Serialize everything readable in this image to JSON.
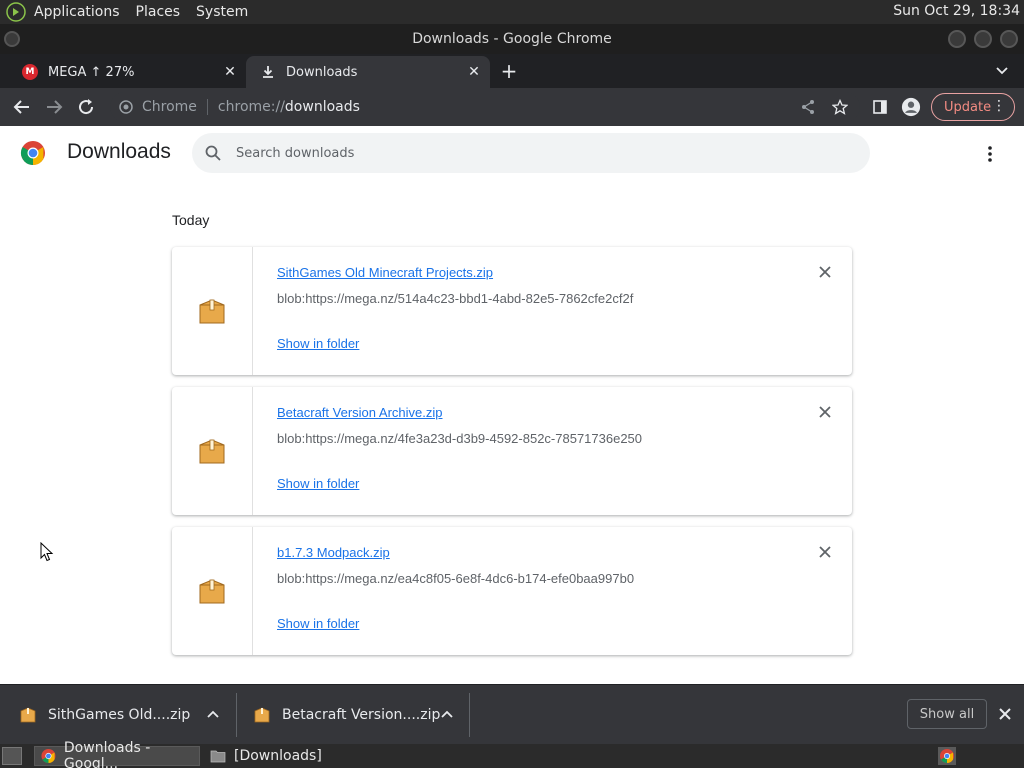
{
  "panel": {
    "menus": [
      "Applications",
      "Places",
      "System"
    ],
    "clock": "Sun Oct 29, 18:34"
  },
  "window": {
    "title": "Downloads - Google Chrome"
  },
  "tabs": [
    {
      "label": "MEGA ↑ 27%",
      "favicon": "mega-icon"
    },
    {
      "label": "Downloads",
      "favicon": "download-icon"
    }
  ],
  "toolbar": {
    "omnibox_chip": "Chrome",
    "url_scheme": "chrome://",
    "url_host": "downloads",
    "update_label": "Update"
  },
  "downloads_page": {
    "title": "Downloads",
    "search_placeholder": "Search downloads",
    "section": "Today",
    "items": [
      {
        "name": "SithGames Old Minecraft Projects.zip",
        "url": "blob:https://mega.nz/514a4c23-bbd1-4abd-82e5-7862cfe2cf2f",
        "action": "Show in folder"
      },
      {
        "name": "Betacraft Version Archive.zip",
        "url": "blob:https://mega.nz/4fe3a23d-d3b9-4592-852c-78571736e250",
        "action": "Show in folder"
      },
      {
        "name": "b1.7.3 Modpack.zip",
        "url": "blob:https://mega.nz/ea4c8f05-6e8f-4dc6-b174-efe0baa997b0",
        "action": "Show in folder"
      }
    ]
  },
  "shelf": {
    "items": [
      {
        "label": "SithGames Old....zip"
      },
      {
        "label": "Betacraft Version....zip"
      }
    ],
    "show_all": "Show all"
  },
  "taskbar": {
    "tasks": [
      "Downloads - Googl...",
      "[Downloads]"
    ]
  },
  "colors": {
    "link": "#1a73e8",
    "chrome_dark": "#35363a",
    "accent_update": "#f28b82"
  }
}
